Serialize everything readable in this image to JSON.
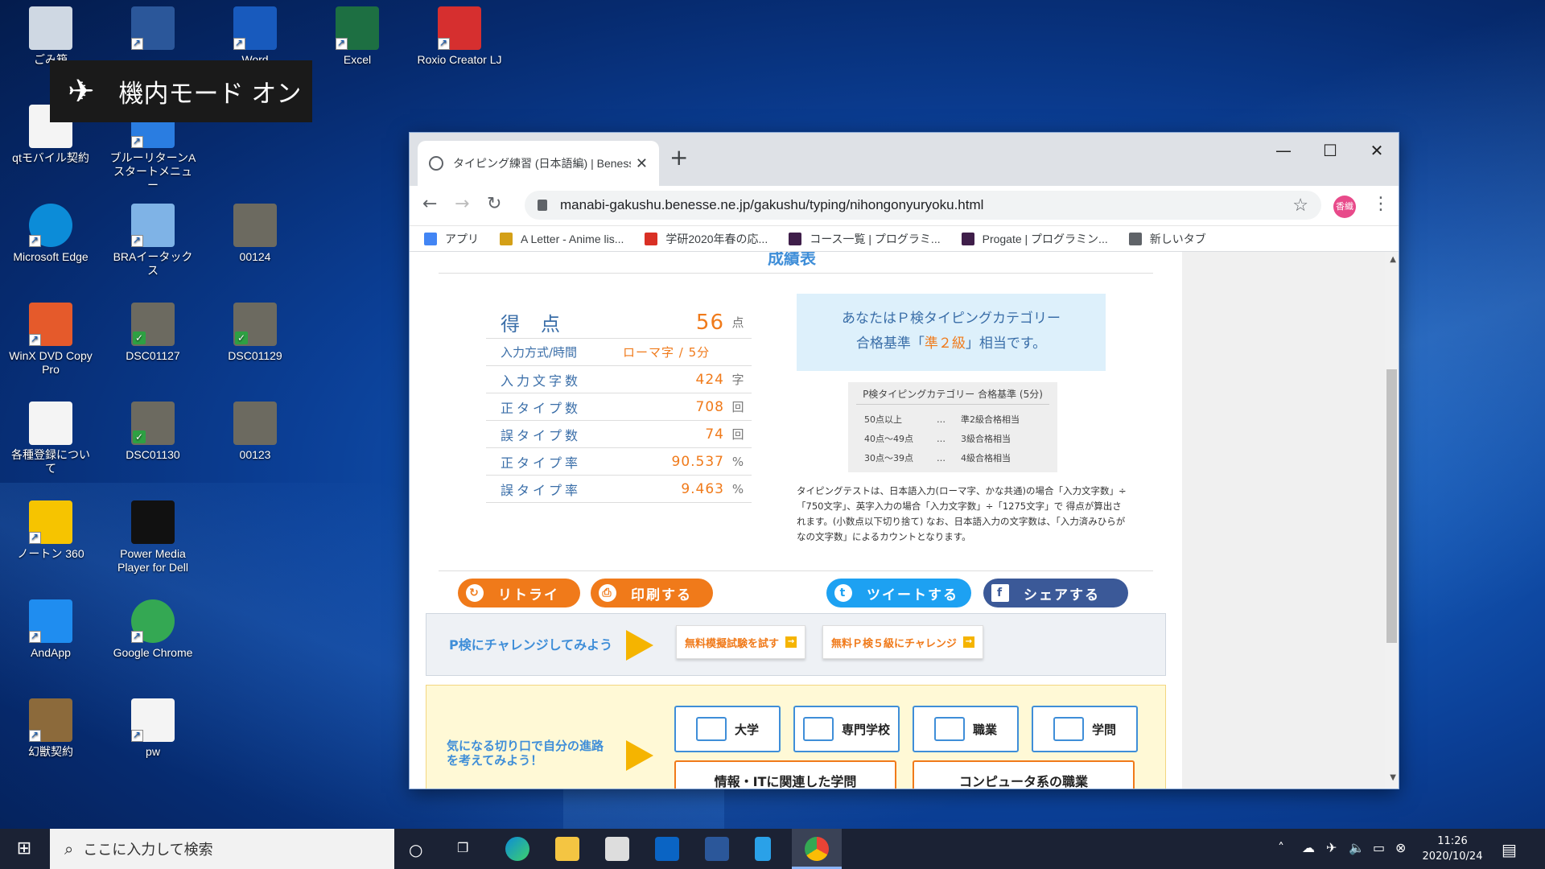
{
  "desktop_icons": [
    {
      "label": "ごみ箱",
      "icon": "recycle-bin-icon"
    },
    {
      "label": "",
      "icon": "word-doc-icon"
    },
    {
      "label": "Word",
      "icon": "word-app-icon"
    },
    {
      "label": "Excel",
      "icon": "excel-app-icon"
    },
    {
      "label": "Roxio Creator LJ",
      "icon": "roxio-icon"
    },
    {
      "label": "qtモバイル契約",
      "icon": "file-icon"
    },
    {
      "label": "ブルーリターンA スタートメニュー",
      "icon": "bluereturn-icon"
    },
    {
      "label": "Microsoft Edge",
      "icon": "edge-icon"
    },
    {
      "label": "BRAイータックス",
      "icon": "etax-icon"
    },
    {
      "label": "00124",
      "icon": "photo-icon"
    },
    {
      "label": "WinX DVD Copy Pro",
      "icon": "winx-icon"
    },
    {
      "label": "DSC01127",
      "icon": "photo-icon"
    },
    {
      "label": "DSC01129",
      "icon": "photo-icon"
    },
    {
      "label": "各種登録について",
      "icon": "file-icon"
    },
    {
      "label": "DSC01130",
      "icon": "photo-icon"
    },
    {
      "label": "00123",
      "icon": "photo-icon"
    },
    {
      "label": "ノートン 360",
      "icon": "norton-icon"
    },
    {
      "label": "Power Media Player for Dell",
      "icon": "media-player-icon"
    },
    {
      "label": "AndApp",
      "icon": "andapp-icon"
    },
    {
      "label": "Google Chrome",
      "icon": "chrome-icon"
    },
    {
      "label": "幻獣契約",
      "icon": "game-icon"
    },
    {
      "label": "pw",
      "icon": "excel-file-icon"
    }
  ],
  "toast": {
    "text": "機内モード オン"
  },
  "browser": {
    "tab_title": "タイピング練習 (日本語編) | Benesse",
    "url": "manabi-gakushu.benesse.ne.jp/gakushu/typing/nihongonyuryoku.html",
    "profile": "香織",
    "bookmarks": [
      {
        "label": "アプリ",
        "color": "#4285f4"
      },
      {
        "label": "A Letter - Anime lis...",
        "color": "#d4a017"
      },
      {
        "label": "学研2020年春の応...",
        "color": "#d93025"
      },
      {
        "label": "コース一覧 | プログラミ...",
        "color": "#3f1e4a"
      },
      {
        "label": "Progate | プログラミン...",
        "color": "#3f1e4a"
      },
      {
        "label": "新しいタブ",
        "color": "#5f6368"
      }
    ]
  },
  "results": {
    "heading": "成績表",
    "score_label": "得点",
    "score_value": "56",
    "score_unit": "点",
    "mode_label": "入力方式/時間",
    "mode_value": "ローマ字 / 5分",
    "rows": [
      {
        "label": "入力文字数",
        "value": "424",
        "unit": "字"
      },
      {
        "label": "正タイプ数",
        "value": "708",
        "unit": "回"
      },
      {
        "label": "誤タイプ数",
        "value": "74",
        "unit": "回"
      },
      {
        "label": "正タイプ率",
        "value": "90.537",
        "unit": "%"
      },
      {
        "label": "誤タイプ率",
        "value": "9.463",
        "unit": "%"
      }
    ],
    "pass_line1": "あなたはＰ検タイピングカテゴリー",
    "pass_pre": "合格基準「",
    "pass_grade": "準２級",
    "pass_post": "」相当です。",
    "criteria_title": "P検タイピングカテゴリー 合格基準 (5分)",
    "criteria": [
      {
        "range": "50点以上",
        "sep": "…",
        "level": "準2級合格相当"
      },
      {
        "range": "40点～49点",
        "sep": "…",
        "level": "3級合格相当"
      },
      {
        "range": "30点～39点",
        "sep": "…",
        "level": "4級合格相当"
      }
    ],
    "note": "タイピングテストは、日本語入力(ローマ字、かな共通)の場合「入力文字数」÷「750文字」、英字入力の場合「入力文字数」÷「1275文字」で 得点が算出されます。(小数点以下切り捨て) なお、日本語入力の文字数は、「入力済みひらがなの文字数」によるカウントとなります。"
  },
  "actions": {
    "retry": "リトライ",
    "print": "印刷する",
    "tweet": "ツイートする",
    "share": "シェアする"
  },
  "challenge": {
    "text": "P検にチャレンジしてみよう",
    "btn1": "無料模擬試験を試す",
    "btn2": "無料Ｐ検５級にチャレンジ"
  },
  "career": {
    "text_line1": "気になる切り口で自分の進路",
    "text_line2": "を考えてみよう！",
    "tiles": [
      "大学",
      "専門学校",
      "職業",
      "学問"
    ],
    "wide1": "情報・ITに関連した学問",
    "wide2": "コンピュータ系の職業"
  },
  "taskbar": {
    "search_placeholder": "ここに入力して検索",
    "time": "11:26",
    "date": "2020/10/24"
  }
}
